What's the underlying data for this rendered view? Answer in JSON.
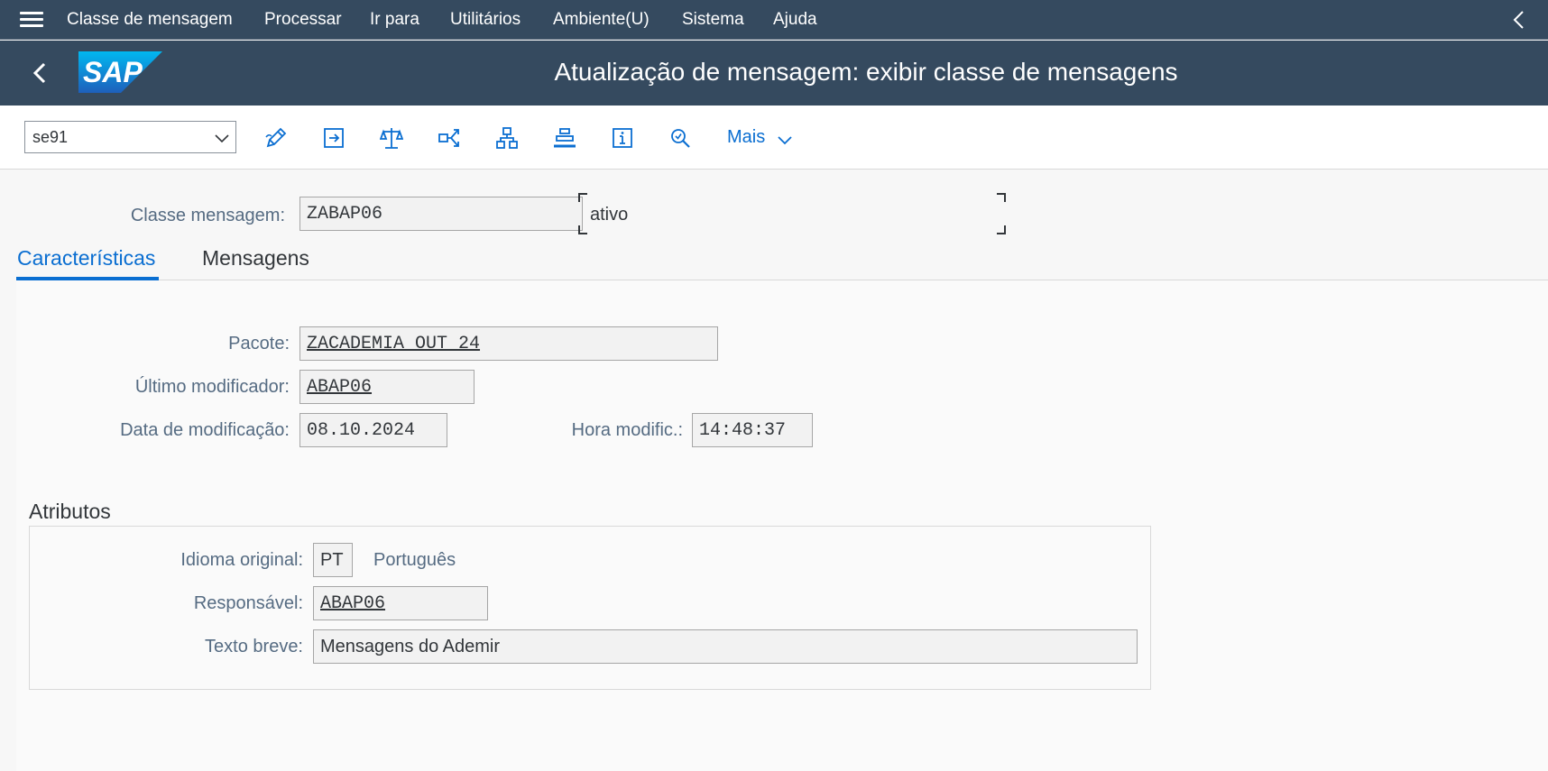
{
  "menubar": {
    "items": [
      "Classe de mensagem",
      "Processar",
      "Ir para",
      "Utilitários",
      "Ambiente(U)",
      "Sistema",
      "Ajuda"
    ]
  },
  "shell": {
    "logo_text": "SAP",
    "title": "Atualização de mensagem: exibir classe de mensagens"
  },
  "toolbar": {
    "command_value": "se91",
    "more_label": "Mais",
    "buttons": [
      "edit-pencil-icon",
      "display-other-icon",
      "balance-scale-icon",
      "connect-icon",
      "hierarchy-icon",
      "where-used-icon",
      "info-icon",
      "search-icon"
    ]
  },
  "header_fields": {
    "message_class_label": "Classe mensagem:",
    "message_class_value": "ZABAP06",
    "status": "ativo"
  },
  "tabs": [
    {
      "label": "Características",
      "active": true
    },
    {
      "label": "Mensagens",
      "active": false
    }
  ],
  "characteristics": {
    "package_label": "Pacote:",
    "package_value": "ZACADEMIA_OUT_24",
    "last_changed_by_label": "Último modificador:",
    "last_changed_by_value": "ABAP06",
    "changed_on_label": "Data de modificação:",
    "changed_on_value": "08.10.2024",
    "changed_at_label": "Hora modific.:",
    "changed_at_value": "14:48:37"
  },
  "attributes": {
    "title": "Atributos",
    "original_language_label": "Idioma original:",
    "original_language_code": "PT",
    "original_language_name": "Português",
    "responsible_label": "Responsável:",
    "responsible_value": "ABAP06",
    "short_text_label": "Texto breve:",
    "short_text_value": "Mensagens do Ademir"
  },
  "colors": {
    "shell": "#354a5f",
    "accent": "#0a6ed1",
    "label": "#556b82"
  }
}
